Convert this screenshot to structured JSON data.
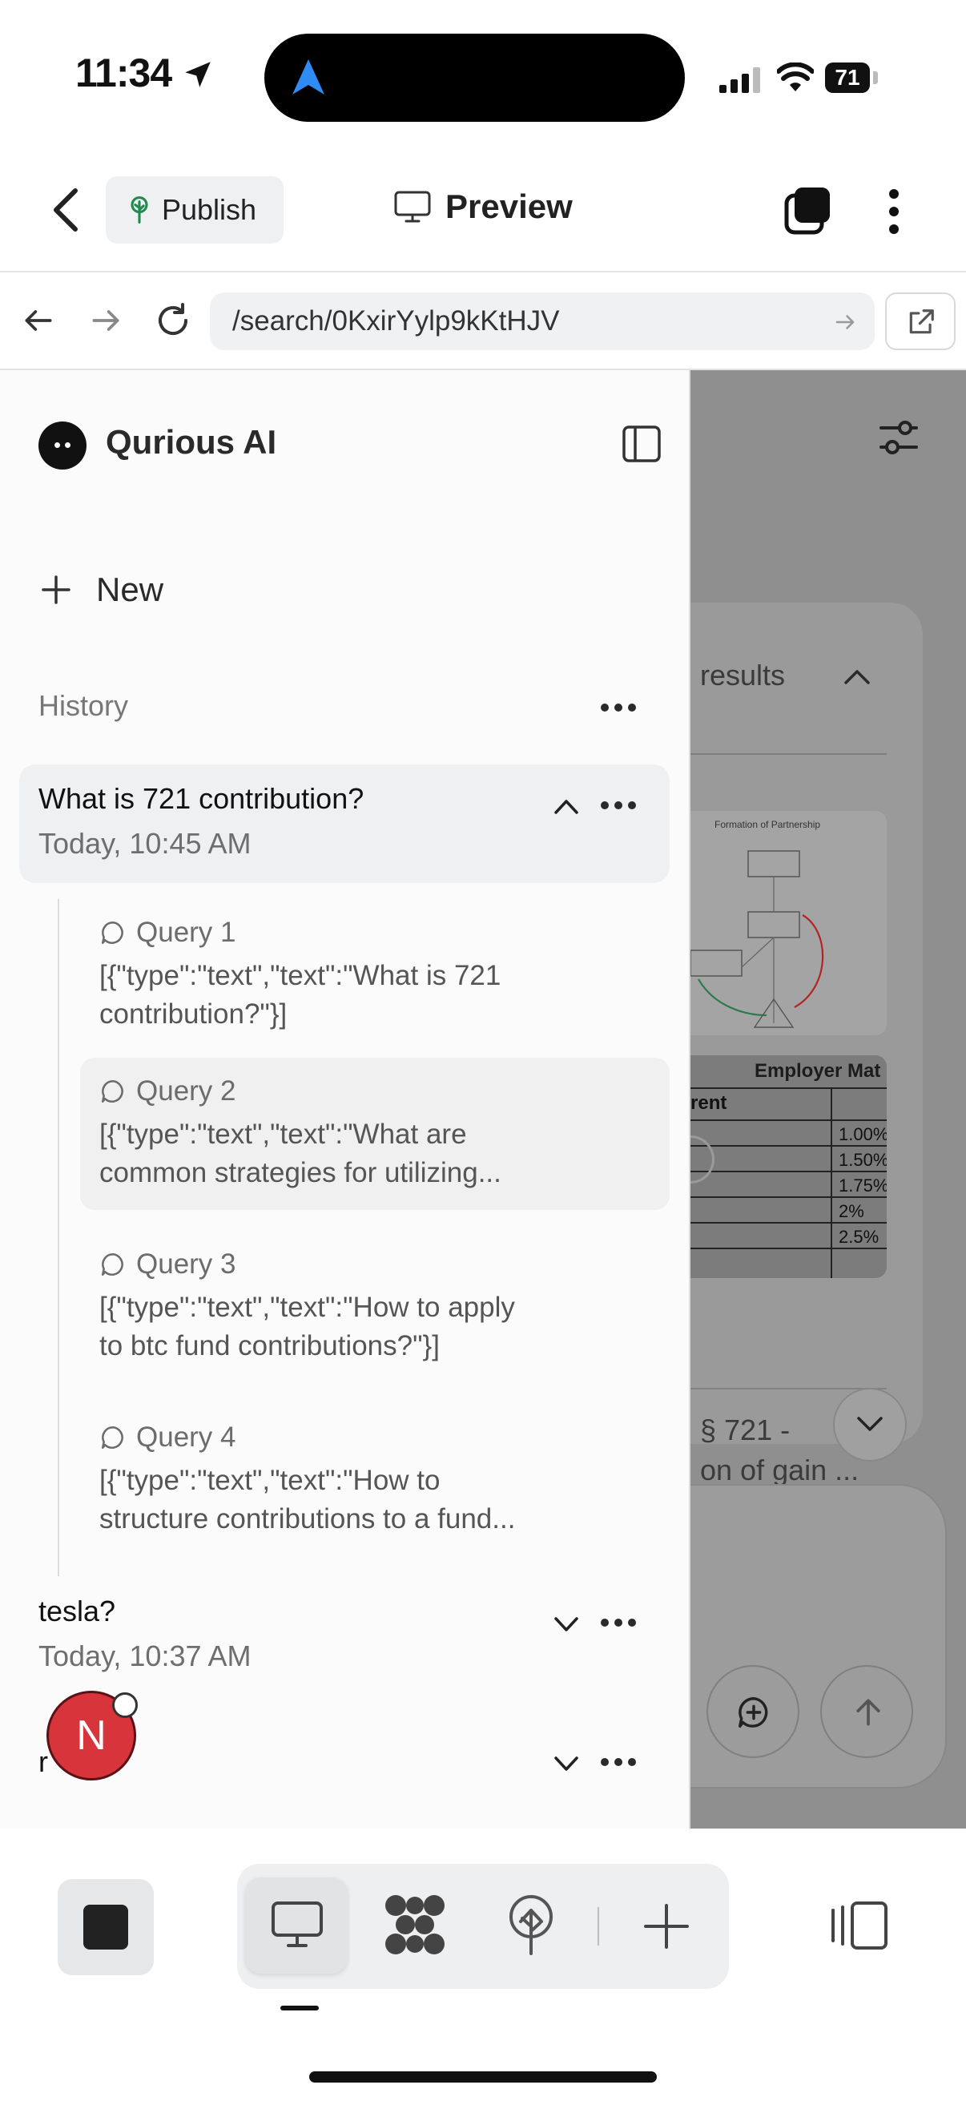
{
  "status": {
    "time": "11:34",
    "battery": "71"
  },
  "topbar": {
    "publish_label": "Publish",
    "preview_label": "Preview"
  },
  "browser": {
    "url": "/search/0KxirYylp9kKtHJV"
  },
  "right_pane": {
    "results_label": "results",
    "figure_title": "Formation of Partnership",
    "table_title": "Employer Mat",
    "table_header": "rent",
    "table_values": [
      "1.00%",
      "1.50%",
      "1.75%",
      "2%",
      "2.5%"
    ],
    "source_title_line1": "§ 721 -",
    "source_title_line2": "on of gain ..."
  },
  "sidebar": {
    "brand": "Qurious AI",
    "new_label": "New",
    "history_label": "History",
    "conversations": [
      {
        "title": "What is 721 contribution?",
        "date": "Today, 10:45 AM",
        "queries": [
          {
            "label": "Query 1",
            "text_line1": "[{\"type\":\"text\",\"text\":\"What is 721",
            "text_line2": "contribution?\"}]"
          },
          {
            "label": "Query 2",
            "text_line1": "[{\"type\":\"text\",\"text\":\"What are",
            "text_line2": "common strategies for utilizing..."
          },
          {
            "label": "Query 3",
            "text_line1": "[{\"type\":\"text\",\"text\":\"How to apply",
            "text_line2": "to btc fund contributions?\"}]"
          },
          {
            "label": "Query 4",
            "text_line1": "[{\"type\":\"text\",\"text\":\"How to",
            "text_line2": "structure contributions to a fund..."
          }
        ]
      },
      {
        "title": "tesla?",
        "date": "Today, 10:37 AM"
      },
      {
        "title": "r"
      }
    ]
  },
  "avatar": {
    "initial": "N",
    "color": "#d8343c"
  },
  "colors": {
    "sidebar_bg": "#fbfbfb",
    "dim_overlay": "#8f8f8f",
    "active_card": "#eff0f2"
  }
}
